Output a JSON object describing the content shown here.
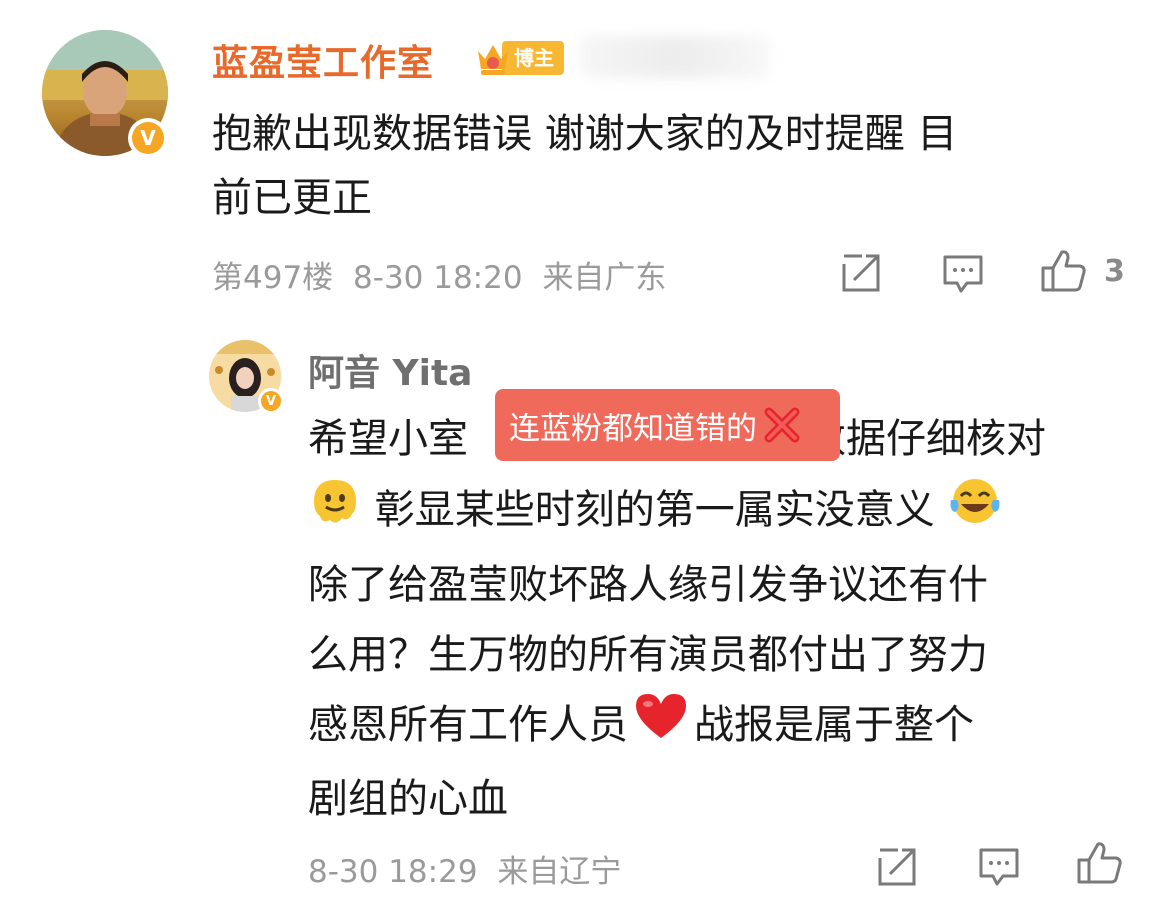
{
  "comment": {
    "username": "蓝盈莹工作室",
    "badge": "博主",
    "text_line1": "抱歉出现数据错误 谢谢大家的及时提醒 目",
    "text_line2": "前已更正",
    "floor": "第497楼",
    "time": "8-30 18:20",
    "location": "来自广东",
    "like_count": "3",
    "icons": [
      "share-icon",
      "comment-icon",
      "like-icon"
    ]
  },
  "reply": {
    "username": "阿音 Yita",
    "overlay_label": "连蓝粉都知道错的",
    "lines": {
      "l1a": "希望小室",
      "l1b": "数据仔细核对",
      "l2": "彰显某些时刻的第一属实没意义",
      "l3": "除了给盈莹败坏路人缘引发争议还有什",
      "l4": "么用？生万物的所有演员都付出了努力",
      "l5a": "感恩所有工作人员",
      "l5b": "战报是属于整个",
      "l6": "剧组的心血"
    },
    "emojis": [
      "melting-face",
      "tears-of-joy",
      "red-heart"
    ],
    "time": "8-30 18:29",
    "location": "来自辽宁"
  },
  "colors": {
    "author_name": "#e8692a",
    "badge_bg": "#f7b733",
    "verified": "#f5a623",
    "meta_gray": "#9a9a9a",
    "overlay": "#f06a5c"
  }
}
